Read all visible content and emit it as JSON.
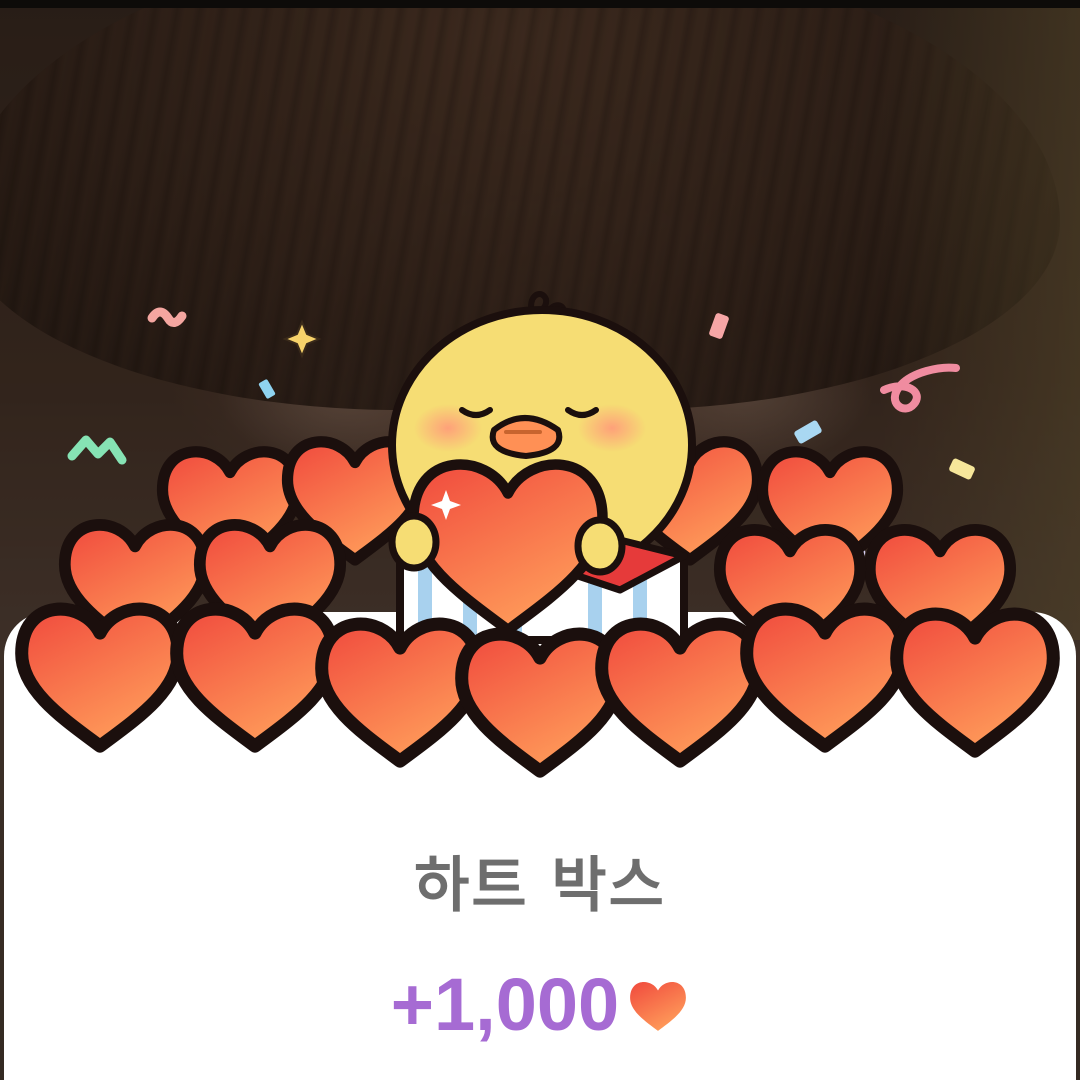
{
  "reward_dialog": {
    "title": "하트 박스",
    "amount": "+1,000",
    "currency_icon": "heart-icon"
  },
  "illustration": {
    "character_icon": "chick-character-icon",
    "heart_count": 17
  },
  "colors": {
    "title": "#6e6e6e",
    "amount": "#a66bd3",
    "heart_fill_top": "#f0533f",
    "heart_fill_bottom": "#ff9a5c",
    "heart_outline": "#1b0f0d",
    "chick_body": "#f6dd74",
    "chick_beak": "#ff9055",
    "box_stripe": "#a8d1ee"
  }
}
